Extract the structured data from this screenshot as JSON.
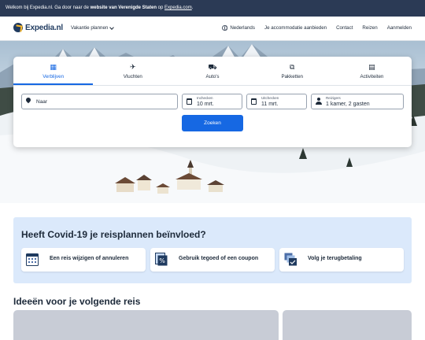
{
  "banner": {
    "prefix": "Welkom bij Expedia.nl. Ga door naar de ",
    "bold": "website van Verenigde Staten",
    "middle": " op ",
    "link": "Expedia.com",
    "suffix": "."
  },
  "header": {
    "logo_text": "Expedia.nl",
    "plan_menu": "Vakantie plannen",
    "nav": {
      "language": "Nederlands",
      "list_property": "Je accommodatie aanbieden",
      "contact": "Contact",
      "trips": "Reizen",
      "sign_in": "Aanmelden"
    }
  },
  "search": {
    "tabs": [
      {
        "label": "Verblijven",
        "icon": "hotel-icon",
        "glyph": "▦"
      },
      {
        "label": "Vluchten",
        "icon": "plane-icon",
        "glyph": "✈"
      },
      {
        "label": "Auto's",
        "icon": "car-icon",
        "glyph": "⛟"
      },
      {
        "label": "Pakketten",
        "icon": "package-icon",
        "glyph": "⧉"
      },
      {
        "label": "Activiteiten",
        "icon": "ticket-icon",
        "glyph": "▤"
      }
    ],
    "active_tab": "Verblijven",
    "destination": {
      "placeholder": "Naar"
    },
    "checkin": {
      "label": "Inchecken",
      "value": "10 mrt."
    },
    "checkout": {
      "label": "Uitchecken",
      "value": "11 mrt."
    },
    "travelers": {
      "label": "Reizigers",
      "value": "1 kamer, 2 gasten"
    },
    "button": "Zoeken"
  },
  "covid": {
    "title": "Heeft Covid-19 je reisplannen beïnvloed?",
    "cards": [
      {
        "label": "Een reis wijzigen of annuleren",
        "icon": "calendar-icon"
      },
      {
        "label": "Gebruik tegoed of een coupon",
        "icon": "coupon-icon"
      },
      {
        "label": "Volg je terugbetaling",
        "icon": "refund-icon"
      }
    ]
  },
  "ideas": {
    "title": "Ideeën voor je volgende reis"
  },
  "colors": {
    "banner_bg": "#2b3a55",
    "primary": "#1668e3",
    "covid_bg": "#dbe9fb",
    "text": "#1d2a3a"
  }
}
